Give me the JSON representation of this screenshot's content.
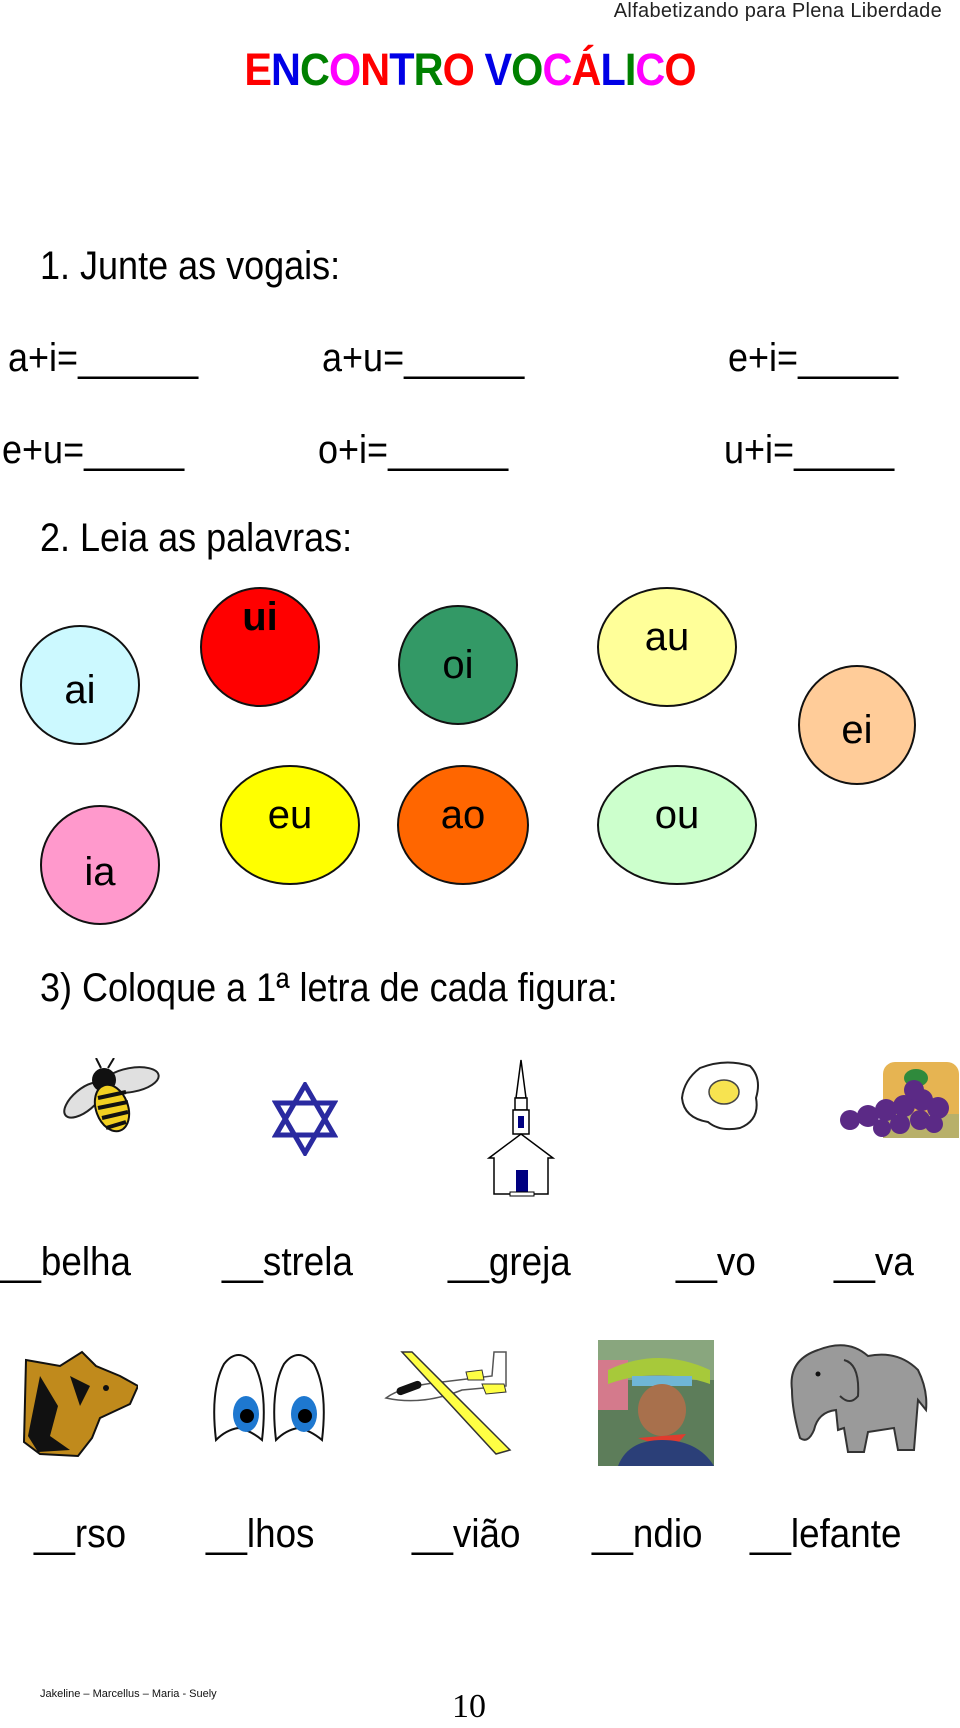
{
  "header": {
    "note": "Alfabetizando para Plena Liberdade"
  },
  "title": {
    "text": "ENCONTRO VOCÁLICO",
    "letters": [
      {
        "ch": "E",
        "color": "#ff0000"
      },
      {
        "ch": "N",
        "color": "#0000e6"
      },
      {
        "ch": "C",
        "color": "#008000"
      },
      {
        "ch": "O",
        "color": "#ff00ff"
      },
      {
        "ch": "N",
        "color": "#ff0000"
      },
      {
        "ch": "T",
        "color": "#0000e6"
      },
      {
        "ch": "R",
        "color": "#008000"
      },
      {
        "ch": "O",
        "color": "#ff0000"
      },
      {
        "ch": " ",
        "color": "#000000"
      },
      {
        "ch": "V",
        "color": "#0000e6"
      },
      {
        "ch": "O",
        "color": "#008000"
      },
      {
        "ch": "C",
        "color": "#ff00ff"
      },
      {
        "ch": "Á",
        "color": "#ff0000"
      },
      {
        "ch": "L",
        "color": "#0000e6"
      },
      {
        "ch": "I",
        "color": "#008000"
      },
      {
        "ch": "C",
        "color": "#ff00ff"
      },
      {
        "ch": "O",
        "color": "#ff0000"
      }
    ]
  },
  "section1": {
    "heading": "1.  Junte as vogais:",
    "sums": [
      "a+i=______",
      "a+u=______",
      "e+i=_____",
      "e+u=_____",
      "o+i=______",
      "u+i=_____"
    ]
  },
  "section2": {
    "heading": "2.  Leia as palavras:",
    "bubbles": [
      {
        "label": "ai",
        "color": "#ccf9ff"
      },
      {
        "label": "ui",
        "color": "#ff0000"
      },
      {
        "label": "oi",
        "color": "#339966"
      },
      {
        "label": "au",
        "color": "#ffff99"
      },
      {
        "label": "ei",
        "color": "#ffcc99"
      },
      {
        "label": "ia",
        "color": "#ff99cc"
      },
      {
        "label": "eu",
        "color": "#ffff00"
      },
      {
        "label": "ao",
        "color": "#ff6600"
      },
      {
        "label": "ou",
        "color": "#ccffcc"
      }
    ]
  },
  "section3": {
    "heading": "3) Coloque a 1ª letra de cada figura:",
    "row1": {
      "pictures": [
        "bee-icon",
        "star-of-david-icon",
        "church-icon",
        "fried-egg-icon",
        "grapes-icon"
      ],
      "words": [
        "__belha",
        "__strela",
        "__greja",
        "__vo",
        "__va"
      ]
    },
    "row2": {
      "pictures": [
        "bear-icon",
        "eyes-icon",
        "airplane-icon",
        "indigenous-man-photo",
        "elephant-icon"
      ],
      "words": [
        "__rso",
        "__lhos",
        "__vião",
        "__ndio",
        "__lefante"
      ]
    }
  },
  "footer": {
    "names": "Jakeline – Marcellus – Maria - Suely",
    "page_number": "10"
  }
}
